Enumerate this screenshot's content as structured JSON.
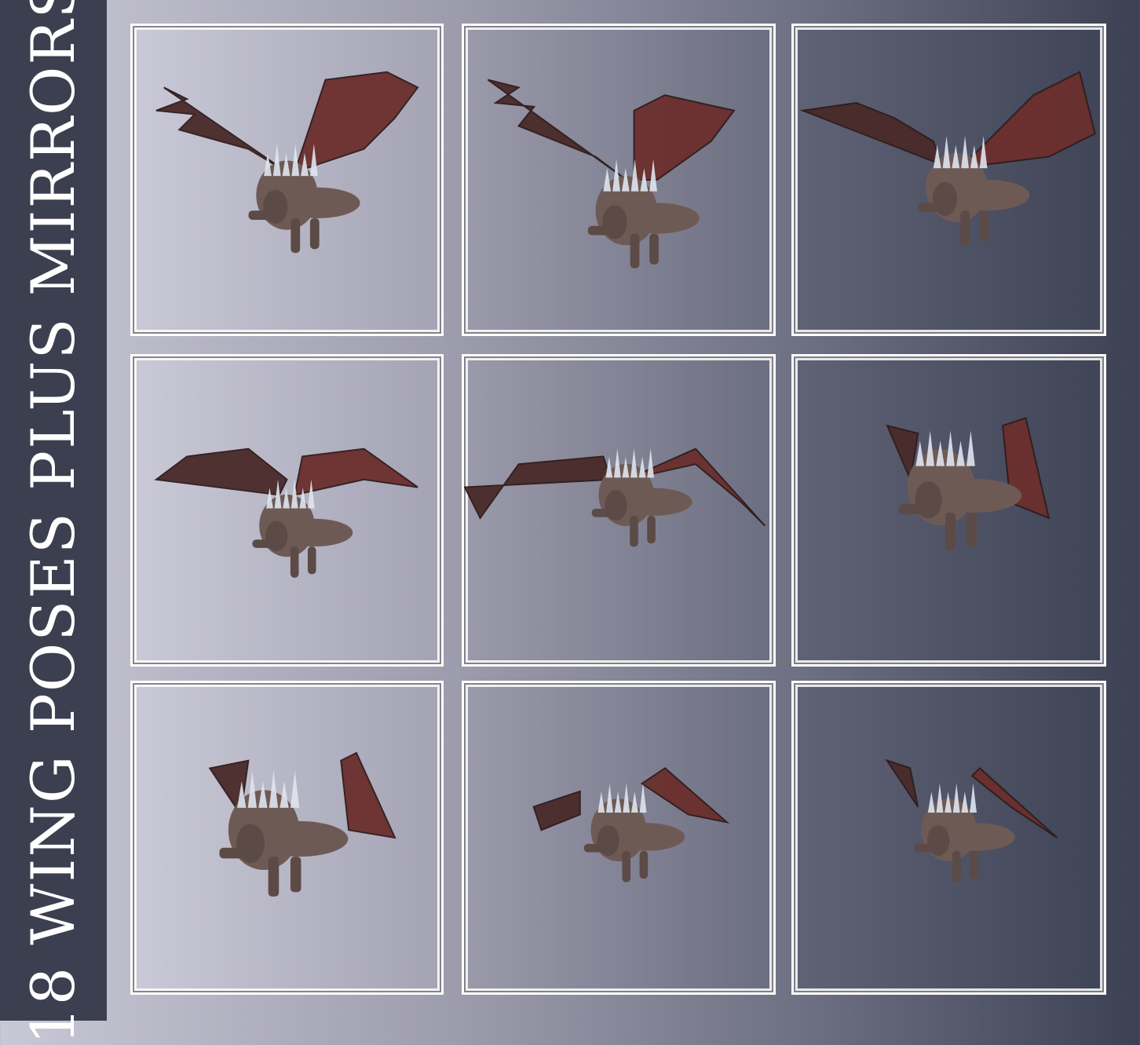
{
  "title": "18 WING POSES PLUS MIRRORS",
  "colors": {
    "sidebar": "#3b3f50",
    "title_text": "#ffffff",
    "frame": "#ffffff",
    "wing": "#4a2a2a",
    "wing_shade": "#6b2f2d",
    "body": "#6e5a55",
    "crystal": "#dfe4ee"
  },
  "tiles": [
    {
      "pose": "wings-raised-high"
    },
    {
      "pose": "wings-raised-angled"
    },
    {
      "pose": "wings-spread-wide-up"
    },
    {
      "pose": "wings-spread-mid"
    },
    {
      "pose": "wings-spread-flat"
    },
    {
      "pose": "wings-folded-back"
    },
    {
      "pose": "wings-half-folded"
    },
    {
      "pose": "wings-low-small"
    },
    {
      "pose": "wings-low-tucked"
    }
  ]
}
